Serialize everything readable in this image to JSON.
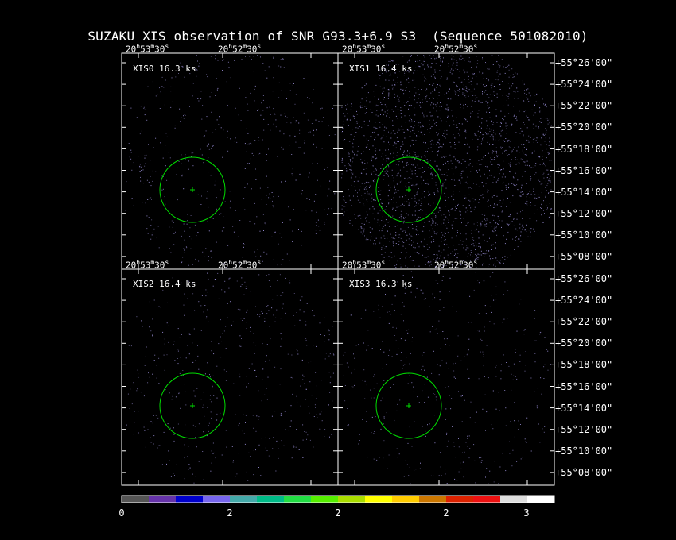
{
  "title": "SUZAKU XIS observation of SNR G93.3+6.9 S3  (Sequence 501082010)",
  "ra_ticks": [
    "20h53m30s",
    "20h52m30s"
  ],
  "dec_ticks": [
    "+55°26'00\"",
    "+55°24'00\"",
    "+55°22'00\"",
    "+55°20'00\"",
    "+55°18'00\"",
    "+55°16'00\"",
    "+55°14'00\"",
    "+55°12'00\"",
    "+55°10'00\"",
    "+55°08'00\""
  ],
  "panels": [
    {
      "label": "XIS0 16.3 ks",
      "density": 0.15
    },
    {
      "label": "XIS1 16.4 ks",
      "density": 1.0
    },
    {
      "label": "XIS2 16.4 ks",
      "density": 0.15
    },
    {
      "label": "XIS3 16.3 ks",
      "density": 0.12
    }
  ],
  "colorbar": {
    "labels": [
      "0",
      "2",
      "2",
      "2",
      "3"
    ],
    "colors": [
      "#555555",
      "#6633aa",
      "#0000cc",
      "#7766ee",
      "#44aaaa",
      "#00bb88",
      "#22dd44",
      "#55ee00",
      "#aadd00",
      "#ffff00",
      "#ffcc00",
      "#cc7700",
      "#dd2200",
      "#ee1111",
      "#dddddd",
      "#ffffff"
    ]
  },
  "colors": {
    "circle": "#00dd00",
    "frame": "#ffffff",
    "photon": "#9a8fd8"
  }
}
